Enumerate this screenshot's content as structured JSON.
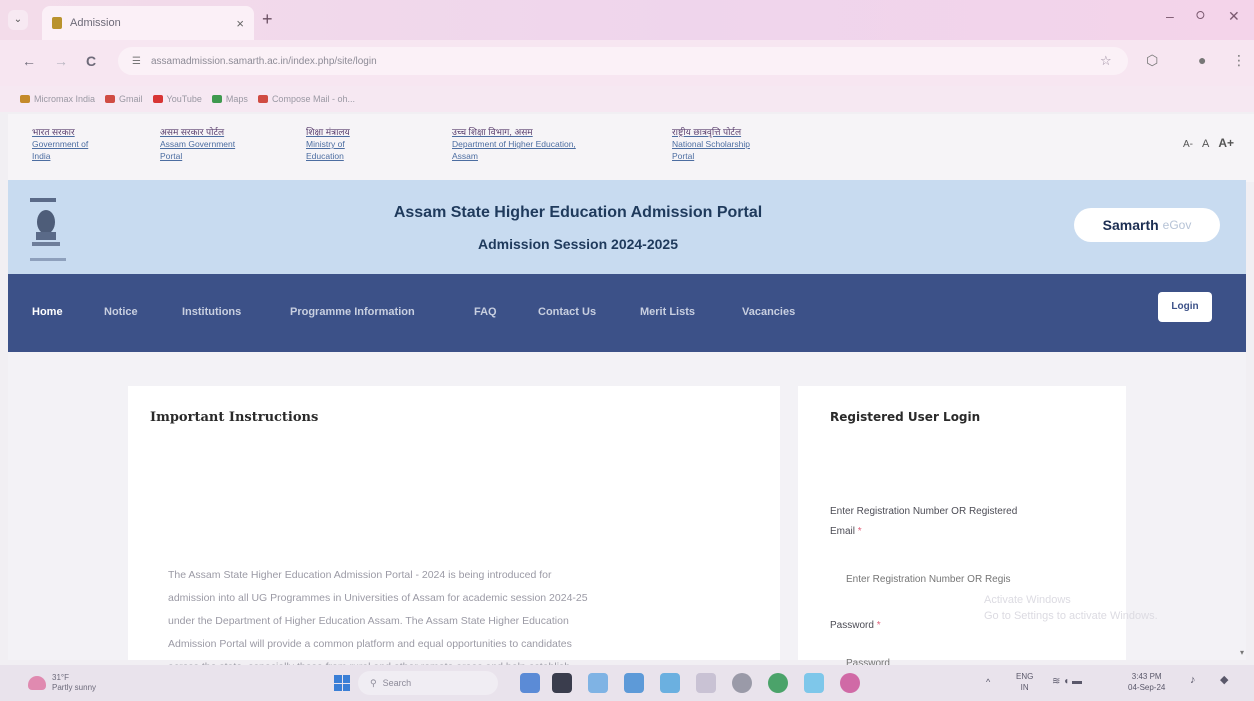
{
  "browser": {
    "tab_title": "Admission",
    "tab_close": "×",
    "new_tab": "+",
    "url": "assamadmission.samarth.ac.in/index.php/site/login",
    "window": {
      "minimize": "–",
      "maximize": "⭘",
      "close": "✕"
    },
    "nav": {
      "back": "←",
      "forward": "→",
      "reload": "C"
    },
    "bookmarks": [
      {
        "label": "Micromax India",
        "color": "#c48a2a"
      },
      {
        "label": "Gmail",
        "color": "#d04c43"
      },
      {
        "label": "YouTube",
        "color": "#d83535"
      },
      {
        "label": "Maps",
        "color": "#3f9a4f"
      },
      {
        "label": "Compose Mail - oh...",
        "color": "#d04c43"
      }
    ]
  },
  "gov_links": [
    {
      "hindi": "भारत सरकार",
      "english": [
        "Government of",
        "India"
      ]
    },
    {
      "hindi": "असम सरकार पोर्टल",
      "english": [
        "Assam Government",
        "Portal"
      ]
    },
    {
      "hindi": "शिक्षा मंत्रालय",
      "english": [
        "Ministry of",
        "Education"
      ]
    },
    {
      "hindi": "उच्च शिक्षा विभाग, असम",
      "english": [
        "Department of Higher Education,",
        "Assam"
      ]
    },
    {
      "hindi": "राष्ट्रीय छात्रवृत्ति पोर्टल",
      "english": [
        "National Scholarship",
        "Portal"
      ]
    }
  ],
  "font_controls": {
    "decrease": "A-",
    "normal": "A",
    "increase": "A+"
  },
  "header": {
    "title": "Assam State Higher Education Admission Portal",
    "subtitle": "Admission Session 2024-2025",
    "brand_primary": "Samarth",
    "brand_secondary": "eGov"
  },
  "nav": {
    "items": [
      "Home",
      "Notice",
      "Institutions",
      "Programme Information",
      "FAQ",
      "Contact Us",
      "Merit Lists",
      "Vacancies"
    ],
    "login": "Login"
  },
  "instructions": {
    "title": "Important Instructions",
    "lines": [
      "The Assam State Higher Education Admission Portal - 2024 is being introduced for",
      "admission into all UG Programmes in Universities of Assam for academic session 2024-25",
      "under the Department of Higher Education Assam. The Assam State Higher Education",
      "Admission Portal will provide a common platform and equal opportunities to candidates",
      "across the state, especially those from rural and other remote areas and help establish"
    ]
  },
  "login_form": {
    "title": "Registered User Login",
    "username_label_1": "Enter Registration Number OR Registered",
    "username_label_2": "Email",
    "username_placeholder": "Enter Registration Number OR Regis",
    "password_label": "Password",
    "password_placeholder": "Password",
    "required_mark": "*"
  },
  "watermark": {
    "line1": "Activate Windows",
    "line2": "Go to Settings to activate Windows."
  },
  "taskbar": {
    "weather_temp": "31°F",
    "weather_desc": "Partly sunny",
    "search": "Search",
    "lang_1": "ENG",
    "lang_2": "IN",
    "time": "3:43 PM",
    "date": "04-Sep-24"
  }
}
